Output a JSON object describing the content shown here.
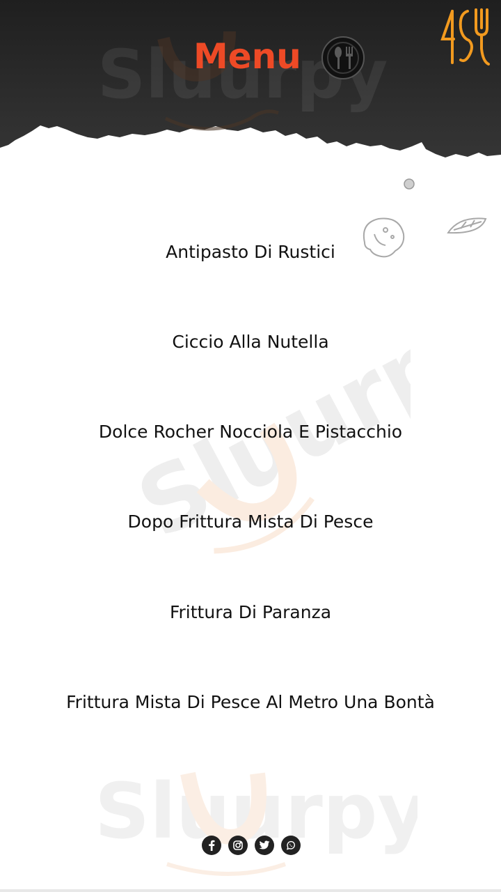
{
  "header": {
    "title": "Menu",
    "title_color": "#ee4a26",
    "background_color": "#2b2b2b",
    "icon": "cutlery-plate-icon",
    "logo_color": "#f29a1f"
  },
  "menu": {
    "items": [
      {
        "label": "Antipasto Di Rustici"
      },
      {
        "label": "Ciccio Alla Nutella"
      },
      {
        "label": "Dolce Rocher Nocciola E Pistacchio"
      },
      {
        "label": "Dopo Frittura Mista Di Pesce"
      },
      {
        "label": "Frittura Di Paranza"
      },
      {
        "label": "Frittura Mista Di Pesce Al Metro Una Bontà"
      }
    ]
  },
  "watermark": {
    "text": "Sluurpy",
    "color": "#d9d9d9"
  },
  "social": [
    {
      "name": "facebook",
      "icon": "facebook-icon"
    },
    {
      "name": "instagram",
      "icon": "instagram-icon"
    },
    {
      "name": "twitter",
      "icon": "twitter-icon"
    },
    {
      "name": "whatsapp",
      "icon": "whatsapp-icon"
    }
  ]
}
